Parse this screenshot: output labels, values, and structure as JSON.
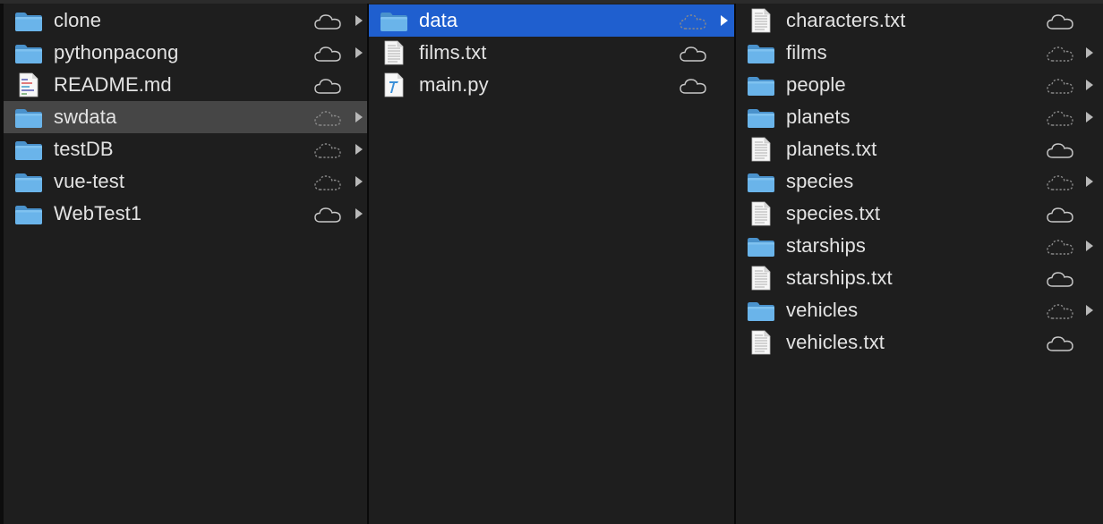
{
  "columns": [
    {
      "items": [
        {
          "name": "clone",
          "kind": "folder",
          "cloud": "downloaded",
          "chevron": true,
          "state": "normal"
        },
        {
          "name": "pythonpacong",
          "kind": "folder",
          "cloud": "downloaded",
          "chevron": true,
          "state": "normal"
        },
        {
          "name": "README.md",
          "kind": "markdown",
          "cloud": "downloaded",
          "chevron": false,
          "state": "normal"
        },
        {
          "name": "swdata",
          "kind": "folder",
          "cloud": "not-downloaded",
          "chevron": true,
          "state": "selected-inactive"
        },
        {
          "name": "testDB",
          "kind": "folder",
          "cloud": "not-downloaded",
          "chevron": true,
          "state": "normal"
        },
        {
          "name": "vue-test",
          "kind": "folder",
          "cloud": "not-downloaded",
          "chevron": true,
          "state": "normal"
        },
        {
          "name": "WebTest1",
          "kind": "folder",
          "cloud": "downloaded",
          "chevron": true,
          "state": "normal"
        }
      ]
    },
    {
      "items": [
        {
          "name": "data",
          "kind": "folder",
          "cloud": "not-downloaded",
          "chevron": true,
          "state": "selected-active"
        },
        {
          "name": "films.txt",
          "kind": "text",
          "cloud": "downloaded",
          "chevron": false,
          "state": "normal"
        },
        {
          "name": "main.py",
          "kind": "python",
          "cloud": "downloaded",
          "chevron": false,
          "state": "normal"
        }
      ]
    },
    {
      "items": [
        {
          "name": "characters.txt",
          "kind": "text",
          "cloud": "downloaded",
          "chevron": false,
          "state": "normal"
        },
        {
          "name": "films",
          "kind": "folder",
          "cloud": "not-downloaded",
          "chevron": true,
          "state": "normal"
        },
        {
          "name": "people",
          "kind": "folder",
          "cloud": "not-downloaded",
          "chevron": true,
          "state": "normal"
        },
        {
          "name": "planets",
          "kind": "folder",
          "cloud": "not-downloaded",
          "chevron": true,
          "state": "normal"
        },
        {
          "name": "planets.txt",
          "kind": "text",
          "cloud": "downloaded",
          "chevron": false,
          "state": "normal"
        },
        {
          "name": "species",
          "kind": "folder",
          "cloud": "not-downloaded",
          "chevron": true,
          "state": "normal"
        },
        {
          "name": "species.txt",
          "kind": "text",
          "cloud": "downloaded",
          "chevron": false,
          "state": "normal"
        },
        {
          "name": "starships",
          "kind": "folder",
          "cloud": "not-downloaded",
          "chevron": true,
          "state": "normal"
        },
        {
          "name": "starships.txt",
          "kind": "text",
          "cloud": "downloaded",
          "chevron": false,
          "state": "normal"
        },
        {
          "name": "vehicles",
          "kind": "folder",
          "cloud": "not-downloaded",
          "chevron": true,
          "state": "normal"
        },
        {
          "name": "vehicles.txt",
          "kind": "text",
          "cloud": "downloaded",
          "chevron": false,
          "state": "normal"
        }
      ]
    }
  ],
  "icons": {
    "folder": "folder-icon",
    "text": "text-file-icon",
    "markdown": "markdown-file-icon",
    "python": "python-file-icon",
    "downloaded": "icloud-downloaded-icon",
    "not-downloaded": "icloud-not-downloaded-icon",
    "chevron": "disclosure-chevron-icon"
  },
  "colors": {
    "background": "#1e1e1e",
    "selected_active": "#1f5fcf",
    "selected_inactive": "#464646",
    "folder_blue": "#5aa8e0",
    "text": "#e3e3e3"
  }
}
